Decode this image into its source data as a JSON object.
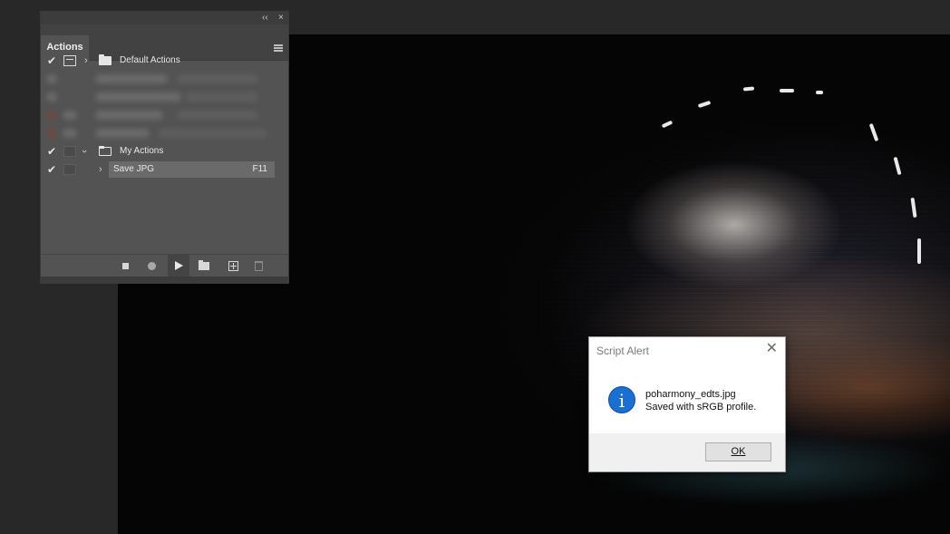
{
  "panel": {
    "tab_label": "Actions",
    "collapse_glyph": "‹‹",
    "close_glyph": "×",
    "rows": [
      {
        "label": "Default Actions",
        "checked": true,
        "shortcut": ""
      },
      {
        "label": "My Actions",
        "checked": true,
        "shortcut": ""
      },
      {
        "label": "Save JPG",
        "checked": true,
        "shortcut": "F11"
      }
    ],
    "footer_icons": [
      "stop-icon",
      "record-icon",
      "play-icon",
      "new-set-icon",
      "new-action-icon",
      "delete-icon"
    ]
  },
  "alert": {
    "title": "Script Alert",
    "close_glyph": "✕",
    "info_glyph": "i",
    "line1": "poharmony_edts.jpg",
    "line2": "Saved with sRGB profile.",
    "ok_label": "OK"
  },
  "colors": {
    "panel_bg": "#535353",
    "workspace_bg": "#282828",
    "info_blue": "#1a6fd1"
  }
}
